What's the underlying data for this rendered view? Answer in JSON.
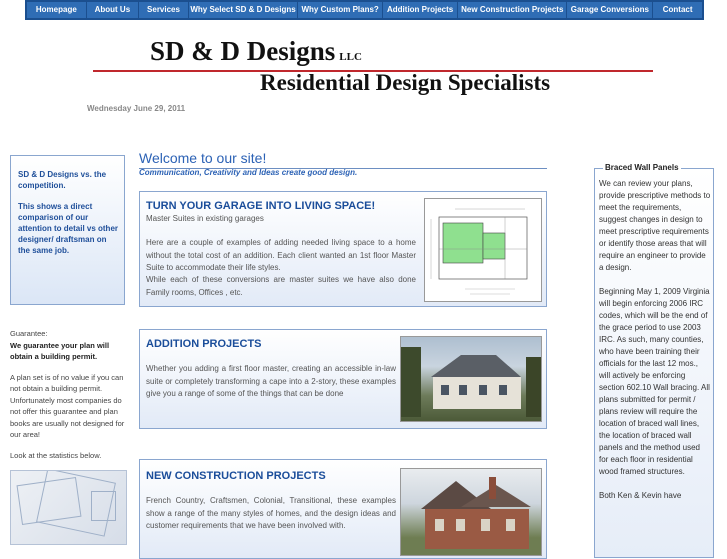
{
  "nav": {
    "items": [
      {
        "label": "Homepage",
        "w": 55
      },
      {
        "label": "About Us",
        "w": 47
      },
      {
        "label": "Services",
        "w": 44
      },
      {
        "label": "Why Select SD & D Designs",
        "w": 110
      },
      {
        "label": "Why Custom Plans?",
        "w": 83
      },
      {
        "label": "Addition Projects",
        "w": 72
      },
      {
        "label": "New Construction Projects",
        "w": 110
      },
      {
        "label": "Garage Conversions",
        "w": 84
      },
      {
        "label": "Contact",
        "w": 44
      }
    ]
  },
  "header": {
    "logo_top": "SD & D Designs",
    "logo_llc": "LLC",
    "logo_bottom": "Residential Design Specialists",
    "date": "Wednesday June 29, 2011"
  },
  "left": {
    "box_line1": "SD & D Designs vs. the competition.",
    "box_line2": "This shows a direct comparison of our attention to detail vs other designer/ draftsman on the same job.",
    "guarantee_label": "Guarantee:",
    "guarantee_bold": "We guarantee your plan will obtain a building permit.",
    "guarantee_text": "A plan set is of no value if you can not obtain a building permit. Unfortunately most companies do not offer this guarantee and plan books are usually not designed for our area!",
    "stats_text": "Look at the statistics below."
  },
  "main": {
    "welcome": "Welcome to our site!",
    "tagline": "Communication, Creativity and Ideas create good design.",
    "panels": [
      {
        "title": "TURN YOUR GARAGE INTO LIVING SPACE!",
        "subtitle": "Master Suites in existing garages",
        "body": "Here are a couple of examples of adding needed living space to a home without the total cost of an addition. Each client wanted an 1st floor Master Suite to accommodate their life styles.",
        "body2": "While each of these conversions are master suites we have also done Family rooms, Offices , etc."
      },
      {
        "title": "ADDITION PROJECTS",
        "body": "Whether you adding a first floor master, creating an accessible in-law suite or completely transforming a cape into a 2-story, these examples give you a range of some of the things that can be done"
      },
      {
        "title": "NEW CONSTRUCTION PROJECTS",
        "body": "French Country, Craftsmen, Colonial, Transitional, these examples show a range of the many styles of homes, and the design ideas and customer requirements that we have been involved with."
      }
    ]
  },
  "right": {
    "title": "Braced Wall Panels",
    "p1": "We can review your plans, provide prescriptive methods to meet the requirements, suggest changes in design to meet prescriptive requirements or identify those areas that will require an engineer to provide a design.",
    "p2": "Beginning May 1, 2009 Virginia will begin enforcing 2006 IRC codes, which will be the end of the grace period to use 2003 IRC. As such, many counties, who have been training their officials for the last 12 mos., will actively be enforcing section 602.10 Wall bracing. All plans submitted for permit / plans review will require the location of braced wall lines, the location of braced wall panels and the method used for each floor in residential wood framed structures.",
    "p3": "Both Ken & Kevin have"
  }
}
